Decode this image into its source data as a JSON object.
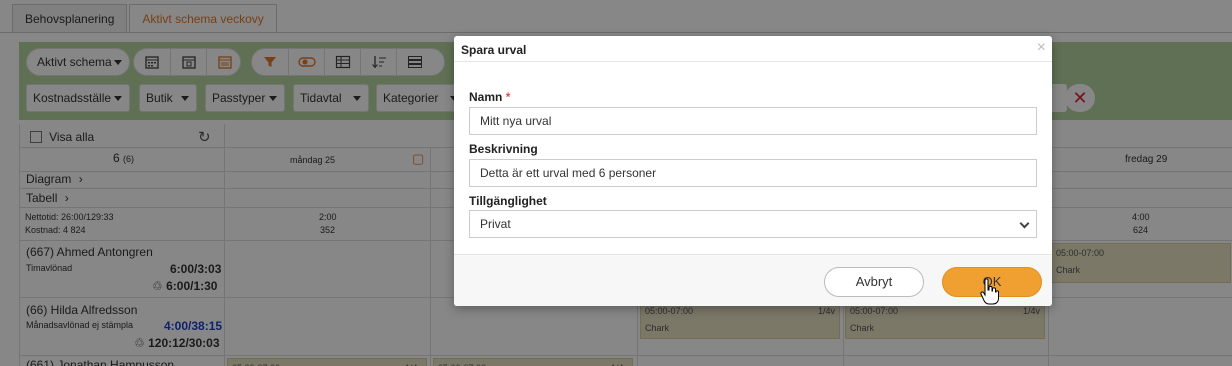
{
  "tabs": [
    {
      "label": "Behovsplanering"
    },
    {
      "label": "Aktivt schema veckovy"
    }
  ],
  "toolbar": {
    "schedule_select": "Aktivt schema",
    "filters": [
      "Kostnadsställe",
      "Butik",
      "Passtyper",
      "Tidavtal",
      "Kategorier"
    ]
  },
  "grid": {
    "show_all": "Visa alla",
    "count": "6",
    "count_sub": "(6)",
    "diagram": "Diagram",
    "table": "Tabell",
    "netto": "Nettotid: 26:00/129:33",
    "cost": "Kostnad: 4 824",
    "days": [
      {
        "label": "måndag 25",
        "time": "2:00",
        "cost": "352"
      },
      {
        "label": "fredag 29",
        "time": "4:00",
        "cost": "624"
      }
    ],
    "employees": [
      {
        "name": "(667) Ahmed Antongren",
        "type": "Timavlönad",
        "v1": "6:00/3:03",
        "v2": "6:00/1:30"
      },
      {
        "name": "(66) Hilda Alfredsson",
        "type": "Månadsavlönad ej stämpla",
        "v1": "4:00/38:15",
        "v2": "120:12/30:03"
      },
      {
        "name": "(661) Jonathan Hampusson"
      }
    ],
    "shift": {
      "time": "05:00-07:00",
      "ratio": "1/4v",
      "label": "Chark"
    }
  },
  "modal": {
    "title": "Spara urval",
    "close": "×",
    "name_label": "Namn",
    "name_required": "*",
    "name_value": "Mitt nya urval",
    "desc_label": "Beskrivning",
    "desc_value": "Detta är ett urval med 6 personer",
    "access_label": "Tillgänglighet",
    "access_value": "Privat",
    "cancel": "Avbryt",
    "ok": "OK"
  },
  "colors": {
    "accent": "#f0a030",
    "panel": "#b5d4a1",
    "tab_active": "#e0792a"
  }
}
